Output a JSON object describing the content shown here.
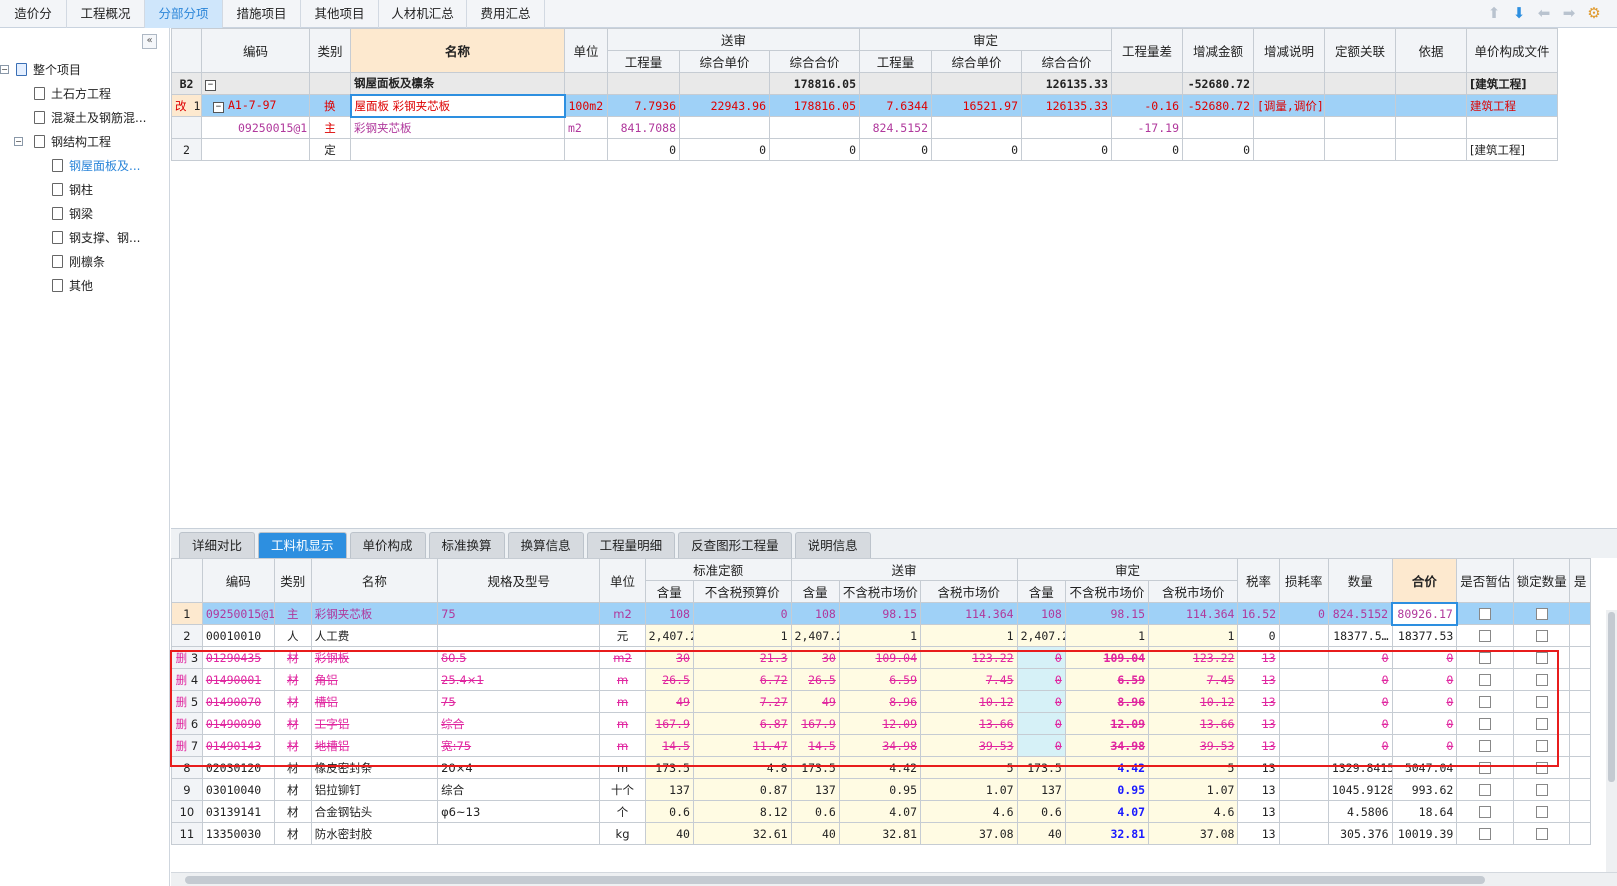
{
  "top_tabs": [
    "造价分析",
    "工程概况",
    "分部分项",
    "措施项目",
    "其他项目",
    "人材机汇总",
    "费用汇总"
  ],
  "active_top_tab": "分部分项",
  "tools": {
    "up": "arrow-up-icon",
    "down": "arrow-down-icon",
    "left": "arrow-left-icon",
    "right": "arrow-right-icon",
    "settings": "settings-icon"
  },
  "sidebar": {
    "collapse_label": "«",
    "root": "整个项目",
    "items": [
      {
        "label": "土石方工程",
        "level": 1
      },
      {
        "label": "混凝土及钢筋混...",
        "level": 1
      },
      {
        "label": "钢结构工程",
        "level": 1
      },
      {
        "label": "钢屋面板及...",
        "level": 2,
        "selected": true
      },
      {
        "label": "钢柱",
        "level": 2
      },
      {
        "label": "钢梁",
        "level": 2
      },
      {
        "label": "钢支撑、钢...",
        "level": 2
      },
      {
        "label": "刚檩条",
        "level": 2
      },
      {
        "label": "其他",
        "level": 2
      }
    ]
  },
  "grid1": {
    "headers": {
      "code": "编码",
      "type": "类别",
      "name": "名称",
      "unit": "单位",
      "submit": "送审",
      "approve": "审定",
      "qty": "工程量",
      "price": "综合单价",
      "total": "综合合价",
      "qty_diff": "工程量差",
      "inc_amt": "增减金额",
      "inc_note": "增减说明",
      "quota_link": "定额关联",
      "basis": "依据",
      "price_file": "单价构成文件"
    },
    "rows": [
      {
        "no": "B2",
        "code": "",
        "type": "",
        "name": "钢屋面板及檩条",
        "unit": "",
        "s_qty": "",
        "s_price": "",
        "s_total": "178816.05",
        "a_qty": "",
        "a_price": "",
        "a_total": "126135.33",
        "diff": "",
        "inc": "-52680.72",
        "note": "",
        "link": "",
        "basis": "",
        "file": "[建筑工程]"
      },
      {
        "no": "1",
        "flag": "改",
        "code": "A1-7-97",
        "type": "换",
        "name": "屋面板 彩钢夹芯板",
        "unit": "100m2",
        "s_qty": "7.7936",
        "s_price": "22943.96",
        "s_total": "178816.05",
        "a_qty": "7.6344",
        "a_price": "16521.97",
        "a_total": "126135.33",
        "diff": "-0.16",
        "inc": "-52680.72",
        "note": "[调量,调价]",
        "link": "",
        "basis": "",
        "file": "建筑工程"
      },
      {
        "no": "",
        "code": "09250015@1",
        "type": "主",
        "name": "彩钢夹芯板",
        "unit": "m2",
        "s_qty": "841.7088",
        "s_price": "",
        "s_total": "",
        "a_qty": "824.5152",
        "a_price": "",
        "a_total": "",
        "diff": "-17.19",
        "inc": "",
        "note": "",
        "link": "",
        "basis": "",
        "file": ""
      },
      {
        "no": "2",
        "code": "",
        "type": "定",
        "name": "",
        "unit": "",
        "s_qty": "0",
        "s_price": "0",
        "s_total": "0",
        "a_qty": "0",
        "a_price": "0",
        "a_total": "0",
        "diff": "0",
        "inc": "0",
        "note": "",
        "link": "",
        "basis": "",
        "file": "[建筑工程]"
      }
    ]
  },
  "bottom_tabs": [
    "详细对比",
    "工料机显示",
    "单价构成",
    "标准换算",
    "换算信息",
    "工程量明细",
    "反查图形工程量",
    "说明信息"
  ],
  "active_bottom_tab": "工料机显示",
  "grid2": {
    "headers": {
      "code": "编码",
      "type": "类别",
      "name": "名称",
      "spec": "规格及型号",
      "unit": "单位",
      "std": "标准定额",
      "submit": "送审",
      "approve": "审定",
      "content": "含量",
      "no_tax_budget": "不含税预算价",
      "no_tax_market": "不含税市场价",
      "tax_market": "含税市场价",
      "tax_rate": "税率",
      "loss_rate": "损耗率",
      "qty": "数量",
      "total": "合价",
      "is_est": "是否暂估",
      "lock_qty": "锁定数量",
      "more": "是"
    },
    "rows": [
      {
        "no": "1",
        "flag": "",
        "code": "09250015@1",
        "type": "主",
        "name": "彩钢夹芯板",
        "spec": "75",
        "unit": "m2",
        "std_c": "108",
        "std_p": "0",
        "s_c": "108",
        "s_nt": "98.15",
        "s_t": "114.364",
        "a_c": "108",
        "a_nt": "98.15",
        "a_t": "114.364",
        "rate": "16.52",
        "loss": "0",
        "qty": "824.5152",
        "total": "80926.17",
        "style": "sel"
      },
      {
        "no": "2",
        "flag": "",
        "code": "00010010",
        "type": "人",
        "name": "人工费",
        "spec": "",
        "unit": "元",
        "std_c": "2,407.2",
        "std_p": "1",
        "s_c": "2,407.2",
        "s_nt": "1",
        "s_t": "1",
        "a_c": "2,407.2",
        "a_nt": "1",
        "a_t": "1",
        "rate": "0",
        "loss": "",
        "qty": "18377.5…",
        "total": "18377.53",
        "style": "normal"
      },
      {
        "no": "3",
        "flag": "删",
        "code": "01290435",
        "type": "材",
        "name": "彩钢板",
        "spec": "δ0.5",
        "unit": "m2",
        "std_c": "30",
        "std_p": "21.3",
        "s_c": "30",
        "s_nt": "109.04",
        "s_t": "123.22",
        "a_c": "0",
        "a_nt": "109.04",
        "a_t": "123.22",
        "rate": "13",
        "loss": "",
        "qty": "0",
        "total": "0",
        "style": "del"
      },
      {
        "no": "4",
        "flag": "删",
        "code": "01490001",
        "type": "材",
        "name": "角铝",
        "spec": "25.4×1",
        "unit": "m",
        "std_c": "26.5",
        "std_p": "6.72",
        "s_c": "26.5",
        "s_nt": "6.59",
        "s_t": "7.45",
        "a_c": "0",
        "a_nt": "6.59",
        "a_t": "7.45",
        "rate": "13",
        "loss": "",
        "qty": "0",
        "total": "0",
        "style": "del"
      },
      {
        "no": "5",
        "flag": "删",
        "code": "01490070",
        "type": "材",
        "name": "槽铝",
        "spec": "75",
        "unit": "m",
        "std_c": "49",
        "std_p": "7.27",
        "s_c": "49",
        "s_nt": "8.96",
        "s_t": "10.12",
        "a_c": "0",
        "a_nt": "8.96",
        "a_t": "10.12",
        "rate": "13",
        "loss": "",
        "qty": "0",
        "total": "0",
        "style": "del"
      },
      {
        "no": "6",
        "flag": "删",
        "code": "01490090",
        "type": "材",
        "name": "工字铝",
        "spec": "综合",
        "unit": "m",
        "std_c": "167.9",
        "std_p": "6.87",
        "s_c": "167.9",
        "s_nt": "12.09",
        "s_t": "13.66",
        "a_c": "0",
        "a_nt": "12.09",
        "a_t": "13.66",
        "rate": "13",
        "loss": "",
        "qty": "0",
        "total": "0",
        "style": "del"
      },
      {
        "no": "7",
        "flag": "删",
        "code": "01490143",
        "type": "材",
        "name": "地槽铝",
        "spec": "宽:75",
        "unit": "m",
        "std_c": "14.5",
        "std_p": "11.47",
        "s_c": "14.5",
        "s_nt": "34.98",
        "s_t": "39.53",
        "a_c": "0",
        "a_nt": "34.98",
        "a_t": "39.53",
        "rate": "13",
        "loss": "",
        "qty": "0",
        "total": "0",
        "style": "del"
      },
      {
        "no": "8",
        "flag": "",
        "code": "02030120",
        "type": "材",
        "name": "橡皮密封条",
        "spec": "20×4",
        "unit": "m",
        "std_c": "173.5",
        "std_p": "4.8",
        "s_c": "173.5",
        "s_nt": "4.42",
        "s_t": "5",
        "a_c": "173.5",
        "a_nt": "4.42",
        "a_t": "5",
        "rate": "13",
        "loss": "",
        "qty": "1329.8415",
        "total": "5047.04",
        "style": "normal"
      },
      {
        "no": "9",
        "flag": "",
        "code": "03010040",
        "type": "材",
        "name": "铝拉铆钉",
        "spec": "综合",
        "unit": "十个",
        "std_c": "137",
        "std_p": "0.87",
        "s_c": "137",
        "s_nt": "0.95",
        "s_t": "1.07",
        "a_c": "137",
        "a_nt": "0.95",
        "a_t": "1.07",
        "rate": "13",
        "loss": "",
        "qty": "1045.9128",
        "total": "993.62",
        "style": "normal"
      },
      {
        "no": "10",
        "flag": "",
        "code": "03139141",
        "type": "材",
        "name": "合金钢钻头",
        "spec": "φ6~13",
        "unit": "个",
        "std_c": "0.6",
        "std_p": "8.12",
        "s_c": "0.6",
        "s_nt": "4.07",
        "s_t": "4.6",
        "a_c": "0.6",
        "a_nt": "4.07",
        "a_t": "4.6",
        "rate": "13",
        "loss": "",
        "qty": "4.5806",
        "total": "18.64",
        "style": "normal"
      },
      {
        "no": "11",
        "flag": "",
        "code": "13350030",
        "type": "材",
        "name": "防水密封胶",
        "spec": "",
        "unit": "kg",
        "std_c": "40",
        "std_p": "32.61",
        "s_c": "40",
        "s_nt": "32.81",
        "s_t": "37.08",
        "a_c": "40",
        "a_nt": "32.81",
        "a_t": "37.08",
        "rate": "13",
        "loss": "",
        "qty": "305.376",
        "total": "10019.39",
        "style": "normal"
      }
    ]
  },
  "colors": {
    "accent": "#2d8fe0",
    "selected_row": "#9fd1f7",
    "deleted_text": "#e0259f",
    "highlight_box": "#e81c1c"
  }
}
